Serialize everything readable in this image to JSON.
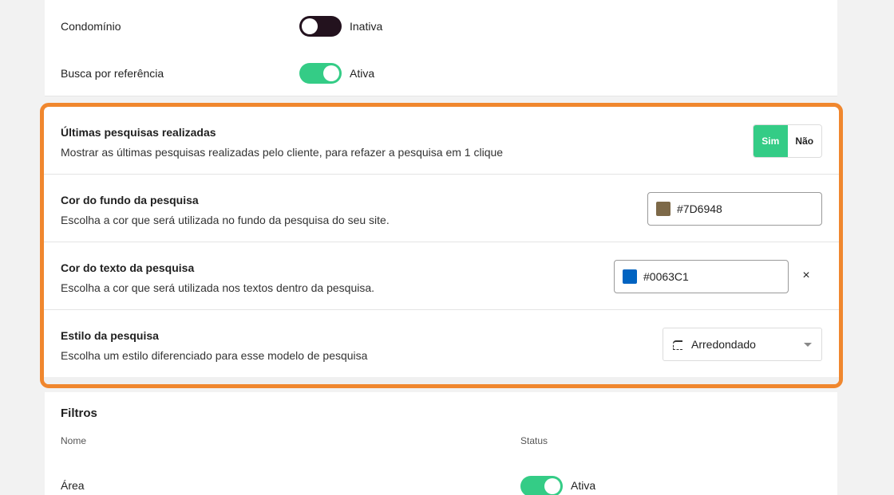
{
  "toggles": [
    {
      "label": "Condomínio",
      "state": "Inativa",
      "on": false
    },
    {
      "label": "Busca por referência",
      "state": "Ativa",
      "on": true
    }
  ],
  "search_settings": {
    "last_searches": {
      "title": "Últimas pesquisas realizadas",
      "description": "Mostrar as últimas pesquisas realizadas pelo cliente, para refazer a pesquisa em 1 clique",
      "options": [
        "Sim",
        "Não"
      ],
      "selected": "Sim"
    },
    "bg_color": {
      "title": "Cor do fundo da pesquisa",
      "description": "Escolha a cor que será utilizada no fundo da pesquisa do seu site.",
      "value": "#7D6948"
    },
    "text_color": {
      "title": "Cor do texto da pesquisa",
      "description": "Escolha a cor que será utilizada nos textos dentro da pesquisa.",
      "value": "#0063C1",
      "clear_icon": "×"
    },
    "style": {
      "title": "Estilo da pesquisa",
      "description": "Escolha um estilo diferenciado para esse modelo de pesquisa",
      "value": "Arredondado"
    }
  },
  "filters": {
    "title": "Filtros",
    "col_name": "Nome",
    "col_status": "Status",
    "rows": [
      {
        "name": "Área",
        "state": "Ativa",
        "on": true
      }
    ]
  },
  "colors": {
    "highlight": "#f0872e",
    "toggle_on": "#34cc86",
    "toggle_off": "#23121e"
  }
}
